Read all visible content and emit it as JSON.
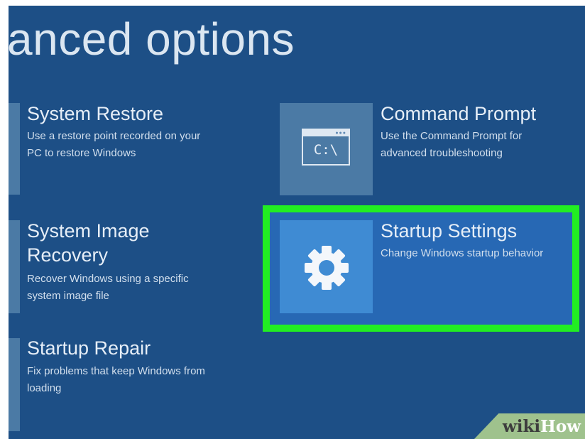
{
  "header": {
    "title": "anced options"
  },
  "options": {
    "system_restore": {
      "title": "System Restore",
      "desc_line1": "Use a restore point recorded on your",
      "desc_line2": "PC to restore Windows"
    },
    "command_prompt": {
      "title": "Command Prompt",
      "desc_line1": "Use the Command Prompt for",
      "desc_line2": "advanced troubleshooting",
      "icon": "command-prompt-icon",
      "icon_text": "C:\\"
    },
    "system_image_recovery": {
      "title_line1": "System Image",
      "title_line2": "Recovery",
      "desc_line1": "Recover Windows using a specific",
      "desc_line2": "system image file"
    },
    "startup_settings": {
      "title": "Startup Settings",
      "desc_line1": "Change Windows startup behavior",
      "icon": "gear-icon"
    },
    "startup_repair": {
      "title": "Startup Repair",
      "desc_line1": "Fix problems that keep Windows from",
      "desc_line2": "loading"
    }
  },
  "watermark": {
    "part1": "wiki",
    "part2": "How"
  },
  "colors": {
    "background": "#1d4f86",
    "tile": "#4b7aa5",
    "highlight_border": "#22ee22",
    "highlight_fill": "#2768b4",
    "highlight_tile": "#3f8bd3"
  }
}
